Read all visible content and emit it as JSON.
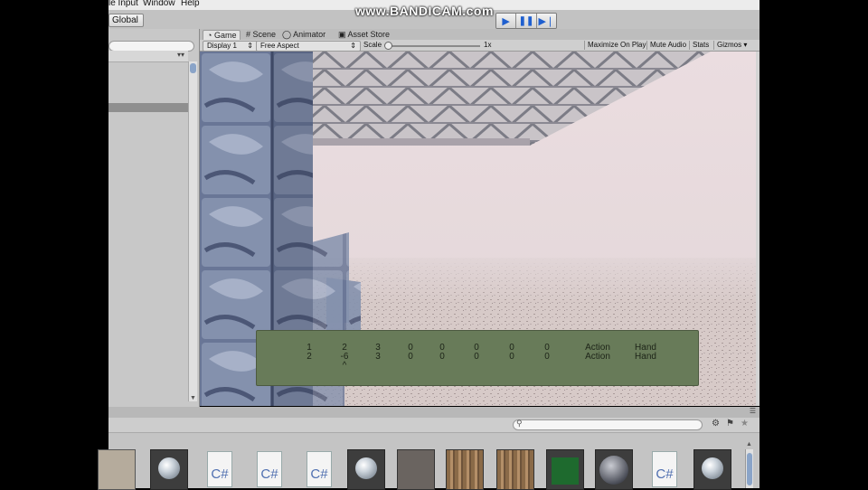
{
  "menubar": {
    "items": [
      "le Input",
      "Window",
      "Help"
    ]
  },
  "toolbar": {
    "global_label": "Global",
    "play_controls": [
      "play",
      "pause",
      "step"
    ],
    "recorder_watermark": "www.BANDICAM.com"
  },
  "game_view": {
    "tabs": [
      {
        "icon": "pacman-icon",
        "label": "Game",
        "active": true
      },
      {
        "icon": "grid-icon",
        "label": "Scene",
        "active": false
      },
      {
        "icon": "animator-icon",
        "label": "Animator",
        "active": false
      },
      {
        "icon": "store-icon",
        "label": "Asset Store",
        "active": false
      }
    ],
    "display": "Display 1",
    "aspect": "Free Aspect",
    "scale_label": "Scale",
    "scale_value": "1x",
    "buttons": {
      "maximize": "Maximize On Play",
      "mute": "Mute Audio",
      "stats": "Stats",
      "gizmos": "Gizmos"
    }
  },
  "hud": {
    "rows": [
      [
        "1",
        "2",
        "3",
        "0",
        "0",
        "0",
        "0",
        "0",
        "Action",
        "Hand"
      ],
      [
        "2",
        "-6",
        "3",
        "0",
        "0",
        "0",
        "0",
        "0",
        "Action",
        "Hand"
      ]
    ],
    "marker": "^"
  },
  "project": {
    "assets": [
      {
        "kind": "texture",
        "name": "stone-texture-thumbnail"
      },
      {
        "kind": "material",
        "name": "material-sphere-icon"
      },
      {
        "kind": "script",
        "label": "C#"
      },
      {
        "kind": "script",
        "label": "C#"
      },
      {
        "kind": "script",
        "label": "C#"
      },
      {
        "kind": "material",
        "name": "material-sphere-icon"
      },
      {
        "kind": "texture",
        "name": "rock-texture-thumbnail"
      },
      {
        "kind": "texture",
        "name": "wood-texture-thumbnail"
      },
      {
        "kind": "texture",
        "name": "wood-texture-thumbnail"
      },
      {
        "kind": "texture",
        "name": "green-texture-thumbnail"
      },
      {
        "kind": "texture",
        "name": "marble-texture-thumbnail"
      },
      {
        "kind": "script",
        "label": "C#"
      },
      {
        "kind": "material",
        "name": "material-sphere-icon"
      }
    ]
  },
  "colors": {
    "hud_bg": "#687b59",
    "play_blue": "#1f5fcf",
    "panel_grey": "#c4c4c4"
  }
}
